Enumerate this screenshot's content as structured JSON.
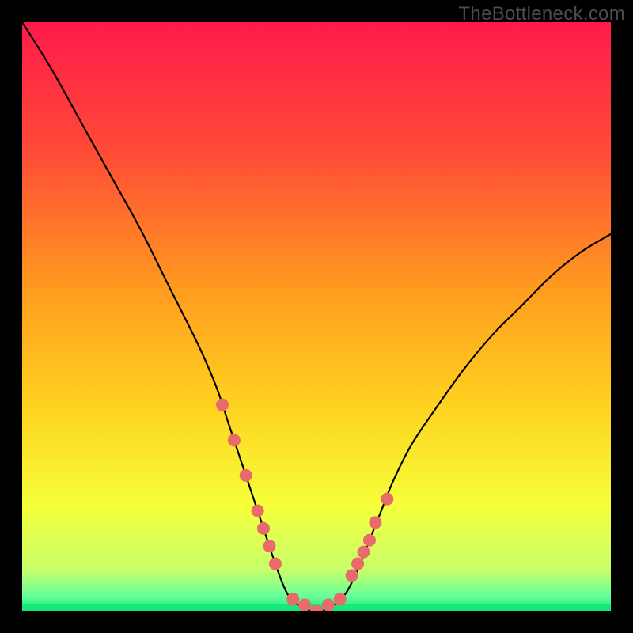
{
  "watermark": "TheBottleneck.com",
  "chart_data": {
    "type": "line",
    "title": "",
    "xlabel": "",
    "ylabel": "",
    "xlim": [
      0,
      100
    ],
    "ylim": [
      0,
      100
    ],
    "notes": "Bottleneck-style V-curve over a rainbow vertical gradient (red→orange→yellow→green). No axis ticks shown. Minimum bottleneck ≈0% around x≈46–54. A thin green band at the very bottom. Salmon-colored marker dots cluster on the descending limb around x≈34–43 and on the ascending limb around x≈56–62, plus dots along the flat bottom.",
    "series": [
      {
        "name": "bottleneck_pct",
        "x": [
          0,
          5,
          10,
          15,
          20,
          25,
          30,
          33,
          35,
          37,
          39,
          41,
          43,
          45,
          47,
          49,
          50,
          51,
          53,
          55,
          57,
          59,
          61,
          63,
          66,
          70,
          75,
          80,
          85,
          90,
          95,
          100
        ],
        "values": [
          100,
          92,
          83,
          74,
          65,
          55,
          45,
          38,
          32,
          26,
          20,
          14,
          8,
          3,
          1,
          0,
          0,
          0,
          1,
          3,
          7,
          12,
          17,
          22,
          28,
          34,
          41,
          47,
          52,
          57,
          61,
          64
        ]
      }
    ],
    "markers": {
      "name": "highlight_points",
      "color": "#e86a6a",
      "x": [
        34,
        36,
        38,
        40,
        41,
        42,
        43,
        46,
        48,
        50,
        52,
        54,
        56,
        57,
        58,
        59,
        60,
        62
      ],
      "values": [
        35,
        29,
        23,
        17,
        14,
        11,
        8,
        2,
        1,
        0,
        1,
        2,
        6,
        8,
        10,
        12,
        15,
        19
      ]
    },
    "gradient_stops": [
      {
        "offset": 0.0,
        "color": "#ff1a4b"
      },
      {
        "offset": 0.22,
        "color": "#ff4b36"
      },
      {
        "offset": 0.45,
        "color": "#ff9a1f"
      },
      {
        "offset": 0.65,
        "color": "#ffd21f"
      },
      {
        "offset": 0.82,
        "color": "#f6ff3a"
      },
      {
        "offset": 0.93,
        "color": "#c8ff6a"
      },
      {
        "offset": 0.975,
        "color": "#66ff99"
      },
      {
        "offset": 1.0,
        "color": "#17e87a"
      }
    ]
  }
}
